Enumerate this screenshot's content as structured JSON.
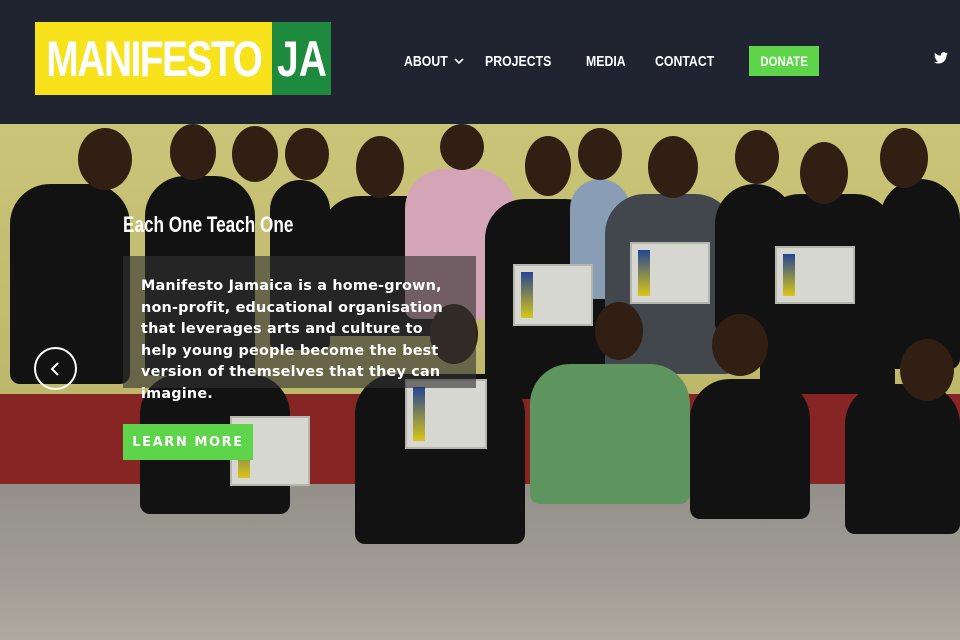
{
  "header": {
    "logo": {
      "main": "MANIFESTO",
      "tag": "JA"
    },
    "nav": {
      "about": "ABOUT",
      "projects": "PROJECTS",
      "media": "MEDIA",
      "contact": "CONTACT",
      "donate": "DONATE"
    },
    "social": {
      "icon": "twitter-icon"
    }
  },
  "hero": {
    "slide_title": "Each One Teach One",
    "slide_text": "Manifesto Jamaica is a home-grown, non-profit, educational organisation that leverages arts and culture to help young people become the best version of themselves that they can imagine.",
    "cta": "LEARN MORE",
    "prev_icon": "chevron-left-icon",
    "colors": {
      "accent_green": "#5ed44a",
      "logo_yellow": "#f7e21b",
      "logo_green": "#1e8a3e",
      "header_bg": "#1f2430"
    }
  }
}
